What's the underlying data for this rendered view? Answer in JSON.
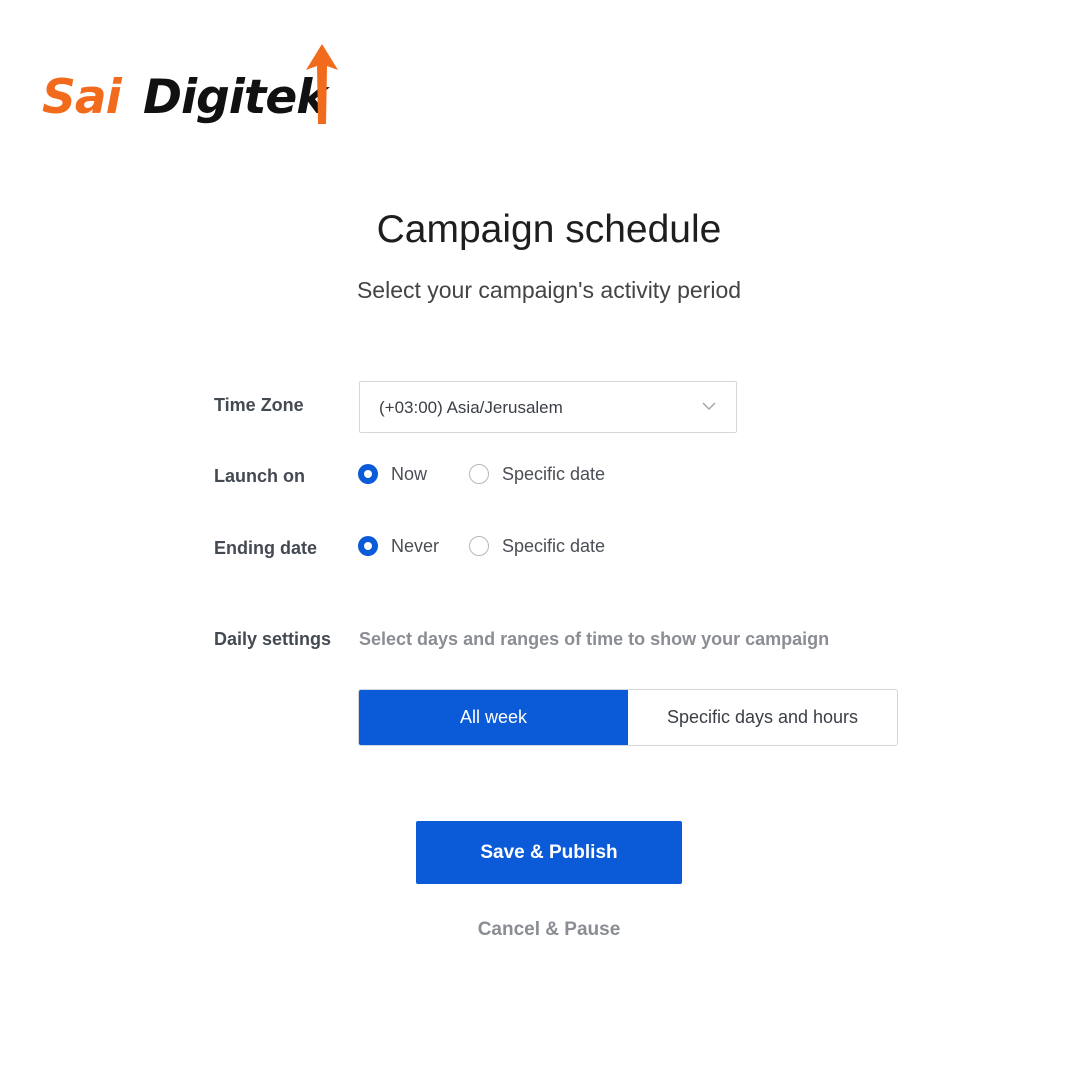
{
  "brand": {
    "name_part1": "Sai",
    "name_part2": "Digitek",
    "accent_color": "#f26a1b",
    "text_color": "#111111",
    "logo_icon": "up-arrow-icon"
  },
  "header": {
    "title": "Campaign schedule",
    "subtitle": "Select your campaign's activity period"
  },
  "form": {
    "time_zone": {
      "label": "Time Zone",
      "value": "(+03:00) Asia/Jerusalem",
      "icon": "chevron-down-icon"
    },
    "launch_on": {
      "label": "Launch on",
      "options": [
        {
          "label": "Now",
          "selected": true
        },
        {
          "label": "Specific date",
          "selected": false
        }
      ]
    },
    "ending_date": {
      "label": "Ending date",
      "options": [
        {
          "label": "Never",
          "selected": true
        },
        {
          "label": "Specific date",
          "selected": false
        }
      ]
    },
    "daily_settings": {
      "label": "Daily settings",
      "description": "Select days and ranges of time to show your campaign",
      "segments": [
        {
          "label": "All week",
          "active": true
        },
        {
          "label": "Specific days and hours",
          "active": false
        }
      ]
    }
  },
  "actions": {
    "primary_label": "Save & Publish",
    "secondary_label": "Cancel & Pause"
  },
  "colors": {
    "primary": "#0b5ad8",
    "muted_text": "#8a8e94",
    "border": "#d4d7dc"
  }
}
